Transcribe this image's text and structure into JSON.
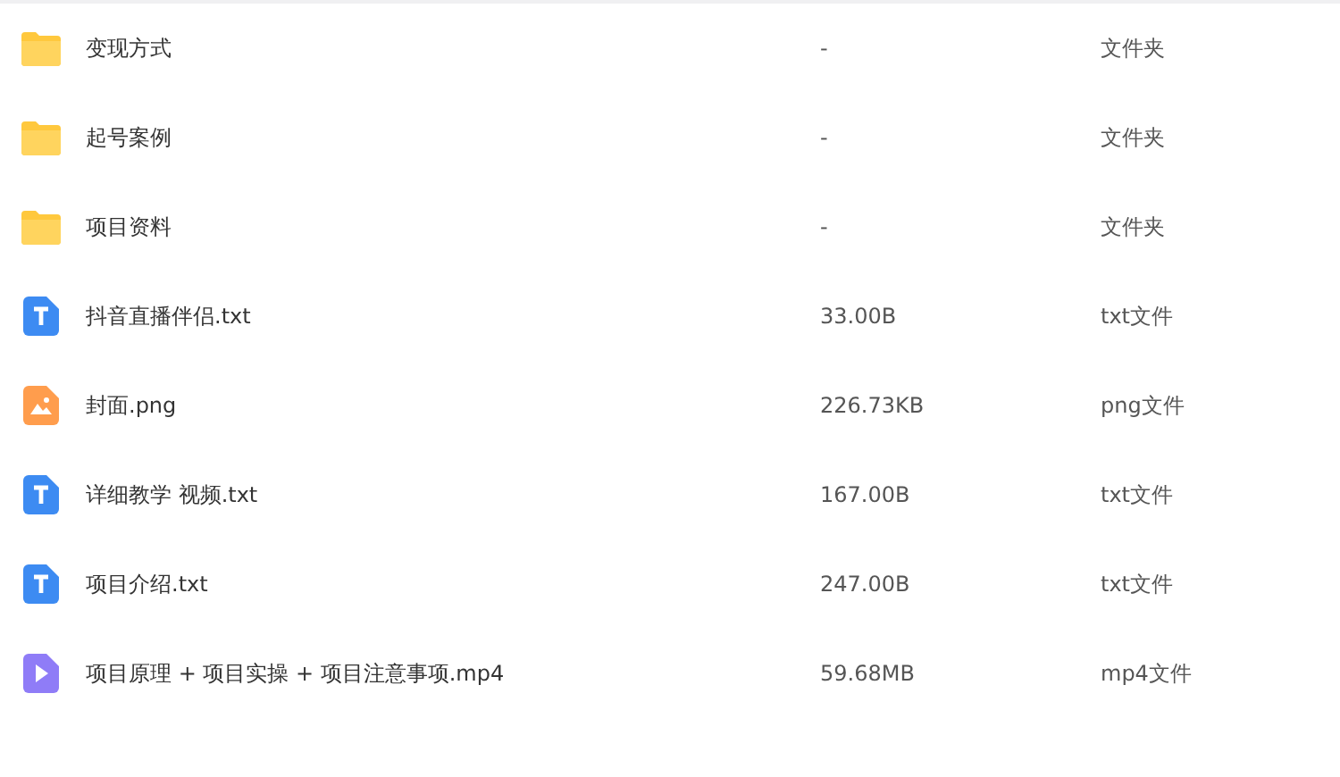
{
  "files": [
    {
      "kind": "folder",
      "name": "变现方式",
      "size": "-",
      "type": "文件夹"
    },
    {
      "kind": "folder",
      "name": "起号案例",
      "size": "-",
      "type": "文件夹"
    },
    {
      "kind": "folder",
      "name": "项目资料",
      "size": "-",
      "type": "文件夹"
    },
    {
      "kind": "text",
      "name": "抖音直播伴侣.txt",
      "size": "33.00B",
      "type": "txt文件"
    },
    {
      "kind": "image",
      "name": "封面.png",
      "size": "226.73KB",
      "type": "png文件"
    },
    {
      "kind": "text",
      "name": "详细教学 视频.txt",
      "size": "167.00B",
      "type": "txt文件"
    },
    {
      "kind": "text",
      "name": "项目介绍.txt",
      "size": "247.00B",
      "type": "txt文件"
    },
    {
      "kind": "video",
      "name": "项目原理 + 项目实操 + 项目注意事项.mp4",
      "size": "59.68MB",
      "type": "mp4文件"
    }
  ]
}
